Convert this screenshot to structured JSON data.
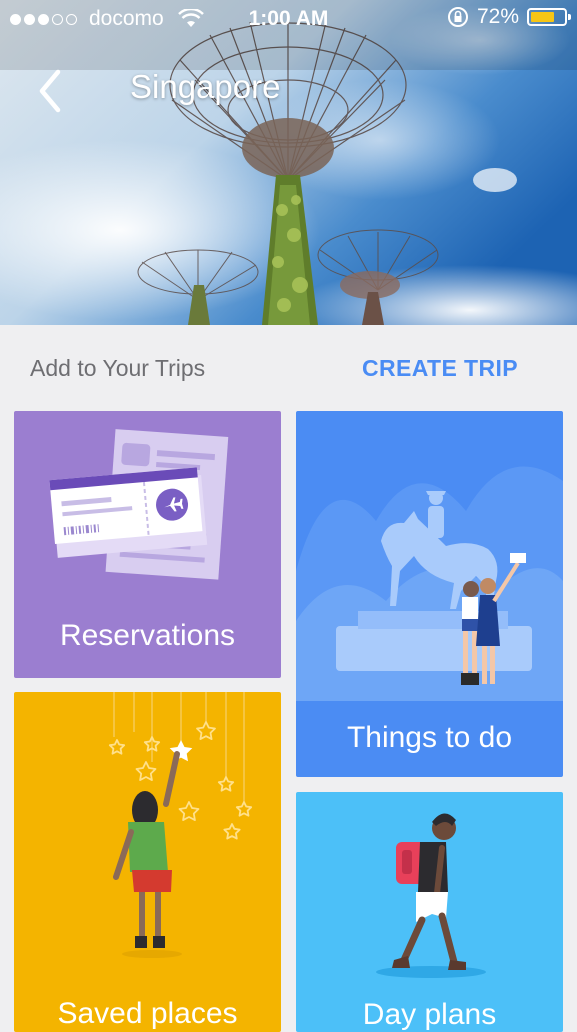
{
  "status_bar": {
    "carrier": "docomo",
    "time": "1:00 AM",
    "battery": "72%",
    "battery_level": 0.72,
    "signal_bars": 3,
    "signal_total": 5
  },
  "header": {
    "title": "Singapore",
    "back_icon": "chevron-left-icon"
  },
  "trips": {
    "label": "Add to Your Trips",
    "create_label": "CREATE TRIP"
  },
  "cards": [
    {
      "label": "Reservations",
      "color": "#9b7ed0"
    },
    {
      "label": "Things to do",
      "color": "#4b8cf3"
    },
    {
      "label": "Saved places",
      "color": "#f4b400"
    },
    {
      "label": "Day plans",
      "color": "#4cc0f8"
    }
  ],
  "colors": {
    "accent": "#4a8cf4",
    "background": "#efeff1"
  }
}
